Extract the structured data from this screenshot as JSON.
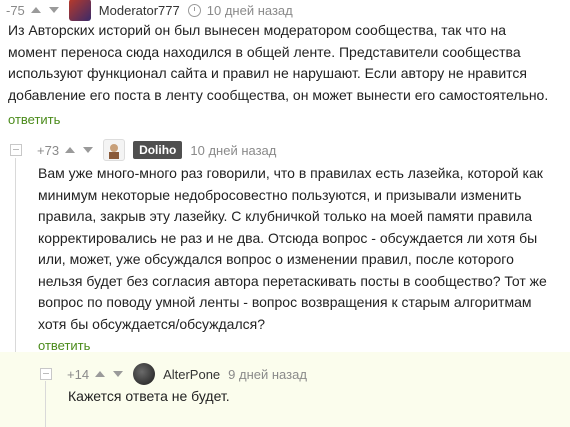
{
  "comments": [
    {
      "rating": "-75",
      "username": "Moderator777",
      "time": "10 дней назад",
      "text": "Из Авторских историй он был вынесен модератором сообщества, так что на момент переноса сюда находился в общей ленте. Представители сообщества используют функционал сайта и правил не нарушают. Если автору не нравится добавление его поста в ленту сообщества, он может вынести его самостоятельно.",
      "reply": "ответить"
    },
    {
      "rating": "+73",
      "username": "Doliho",
      "time": "10 дней назад",
      "text": "Вам уже много-много раз говорили, что в правилах есть лазейка, которой как минимум некоторые недобросовестно пользуются, и призывали изменить правила, закрыв эту лазейку. С клубничкой только на моей памяти правила корректировались не раз и не два. Отсюда вопрос - обсуждается ли хотя бы или, может, уже обсуждался вопрос о изменении правил, после которого нельзя будет без согласия автора перетаскивать посты в сообщество? Тот же вопрос по поводу умной ленты - вопрос возвращения к старым алгоритмам хотя бы обсуждается/обсуждался?",
      "reply": "ответить"
    },
    {
      "rating": "+14",
      "username": "AlterPone",
      "time": "9 дней назад",
      "text": "Кажется ответа не будет."
    }
  ],
  "colors": {
    "reply_green": "#4a8a1a",
    "highlight_bg": "#fbfded",
    "badge_bg": "#4f4f4f"
  },
  "icons": [
    "arrow-up-icon",
    "arrow-down-icon",
    "clock-icon",
    "collapse-icon"
  ]
}
